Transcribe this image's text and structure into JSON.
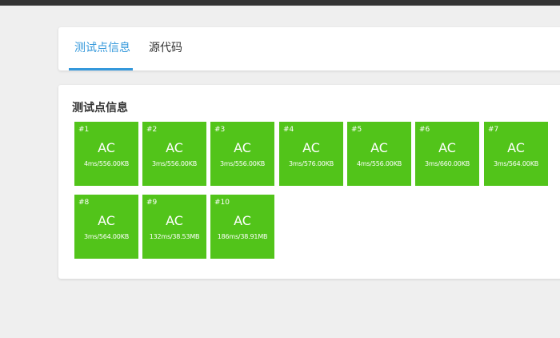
{
  "tabs": {
    "test_info": "测试点信息",
    "source_code": "源代码"
  },
  "section_title": "测试点信息",
  "accent_color": "#3498db",
  "ac_color": "#52c41a",
  "cases": [
    {
      "id": "#1",
      "status": "AC",
      "stats": "4ms/556.00KB"
    },
    {
      "id": "#2",
      "status": "AC",
      "stats": "3ms/556.00KB"
    },
    {
      "id": "#3",
      "status": "AC",
      "stats": "3ms/556.00KB"
    },
    {
      "id": "#4",
      "status": "AC",
      "stats": "3ms/576.00KB"
    },
    {
      "id": "#5",
      "status": "AC",
      "stats": "4ms/556.00KB"
    },
    {
      "id": "#6",
      "status": "AC",
      "stats": "3ms/660.00KB"
    },
    {
      "id": "#7",
      "status": "AC",
      "stats": "3ms/564.00KB"
    },
    {
      "id": "#8",
      "status": "AC",
      "stats": "3ms/564.00KB"
    },
    {
      "id": "#9",
      "status": "AC",
      "stats": "132ms/38.53MB"
    },
    {
      "id": "#10",
      "status": "AC",
      "stats": "186ms/38.91MB"
    }
  ]
}
